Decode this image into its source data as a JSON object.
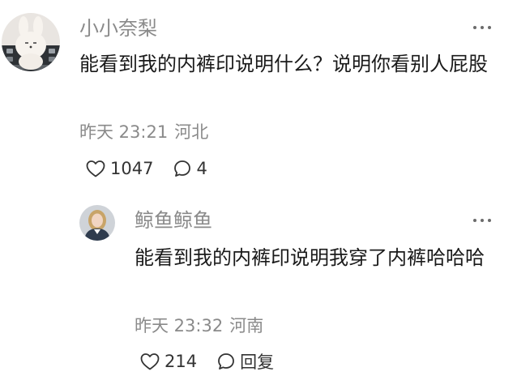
{
  "comment": {
    "username": "小小奈梨",
    "content": "能看到我的内裤印说明什么？说明你看别人屁股",
    "time": "昨天 23:21",
    "location": "河北",
    "likes": "1047",
    "replies": "4"
  },
  "reply": {
    "username": "鲸鱼鲸鱼",
    "content": "能看到我的内裤印说明我穿了内裤哈哈哈",
    "time": "昨天 23:32",
    "location": "河南",
    "likes": "214",
    "reply_label": "回复"
  },
  "colors": {
    "username": "#8a8a8a",
    "content": "#1a1a1a",
    "meta": "#8a8a8a",
    "icon": "#333333"
  },
  "icons": {
    "like": "heart-outline-icon",
    "reply": "speech-bubble-icon",
    "more": "ellipsis-icon"
  }
}
